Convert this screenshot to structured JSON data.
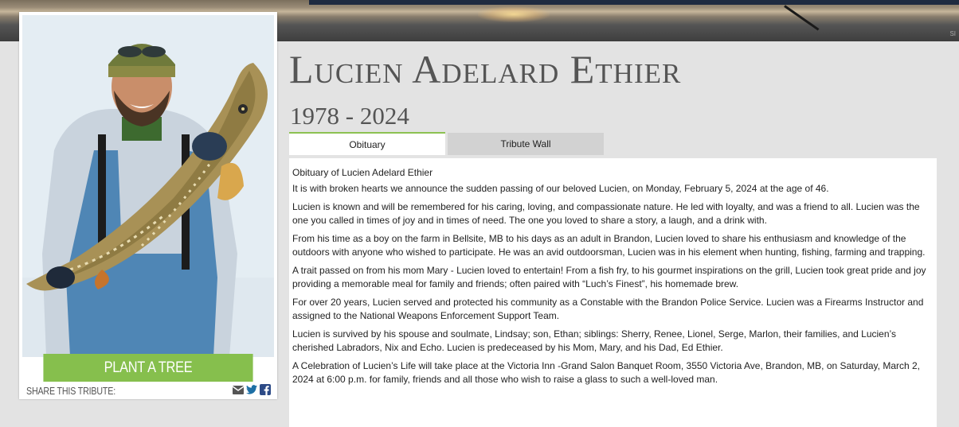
{
  "banner": {
    "small_text": "SI"
  },
  "person": {
    "name": "Lucien Adelard Ethier",
    "dates": "1978 - 2024"
  },
  "actions": {
    "plant_tree": "PLANT A TREE",
    "share_label": "SHARE THIS TRIBUTE:",
    "share_icons": [
      "email-icon",
      "twitter-icon",
      "facebook-icon"
    ]
  },
  "tabs": [
    {
      "label": "Obituary",
      "active": true
    },
    {
      "label": "Tribute Wall",
      "active": false
    }
  ],
  "obituary": {
    "heading": "Obituary of Lucien Adelard Ethier",
    "paragraphs": [
      "It is with broken hearts we announce the sudden passing of our beloved Lucien, on Monday, February 5, 2024 at the age of 46.",
      "Lucien is known and will be remembered for his caring, loving, and compassionate nature. He led with loyalty, and was a friend to all. Lucien was the one you called in times of joy and in times of need. The one you loved to share a story, a laugh, and a drink with.",
      "From his time as a boy on the farm in Bellsite, MB to his days as an adult in Brandon, Lucien loved to share his enthusiasm and knowledge of the outdoors with anyone who wished to participate. He was an avid outdoorsman, Lucien was in his element when hunting, fishing, farming and trapping.",
      "A trait passed on from his mom Mary - Lucien loved to entertain! From a fish fry, to his gourmet inspirations on the grill, Lucien took great pride and joy providing a memorable meal for family and friends; often paired with “Luch’s Finest”, his homemade brew.",
      "For over 20 years, Lucien served and protected his community as a Constable with the Brandon Police Service. Lucien was a Firearms Instructor and assigned to the National Weapons Enforcement Support Team.",
      "Lucien is survived by his spouse and soulmate, Lindsay; son, Ethan; siblings: Sherry, Renee, Lionel, Serge, Marlon, their families, and Lucien’s cherished Labradors, Nix and Echo. Lucien is predeceased by his Mom, Mary, and his Dad, Ed Ethier.",
      "A Celebration of Lucien’s Life will take place at the Victoria Inn -Grand Salon Banquet Room, 3550 Victoria Ave, Brandon, MB, on Saturday, March 2, 2024 at 6:00 p.m. for family, friends and all those who wish to raise a glass to such a well-loved man."
    ]
  },
  "colors": {
    "accent_green": "#86bf4d",
    "tab_active_border": "#8cc152",
    "heading_gray": "#555555",
    "background": "#e3e3e3"
  }
}
